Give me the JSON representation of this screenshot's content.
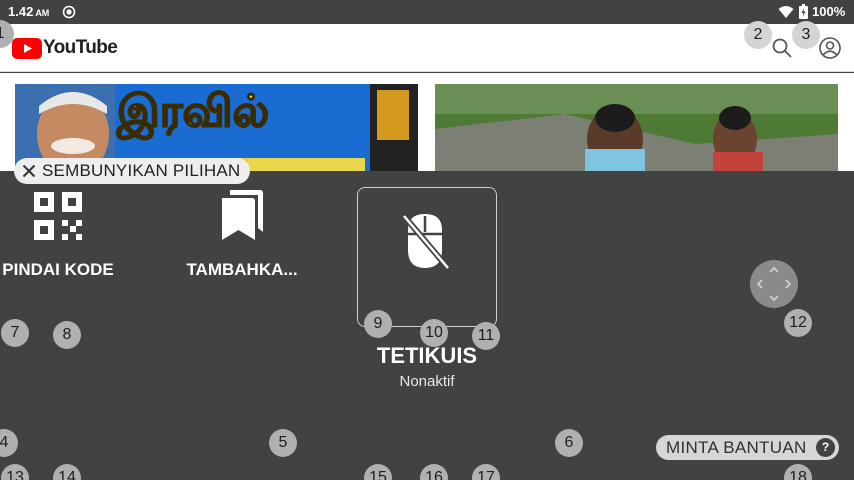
{
  "status_bar": {
    "time": "1.42",
    "ampm": "AM",
    "battery": "100%"
  },
  "youtube": {
    "wordmark": "YouTube"
  },
  "thumbnails": {
    "video1_title_text": "இரவில்"
  },
  "overlay": {
    "hide_label": "SEMBUNYIKAN PILIHAN",
    "scan_code_label": "PINDAI KODE",
    "bookmark_label": "TAMBAHKA...",
    "mouse_title": "TETIKUIS",
    "mouse_status": "Nonaktif",
    "help_label": "MINTA BANTUAN",
    "help_q": "?"
  },
  "badges": [
    "1",
    "2",
    "3",
    "4",
    "5",
    "6",
    "7",
    "8",
    "9",
    "10",
    "11",
    "12",
    "13",
    "14",
    "15",
    "16",
    "17",
    "18"
  ],
  "colors": {
    "panel": "#424242",
    "youtube_red": "#ff0000",
    "badge": "#b0b0b0"
  }
}
